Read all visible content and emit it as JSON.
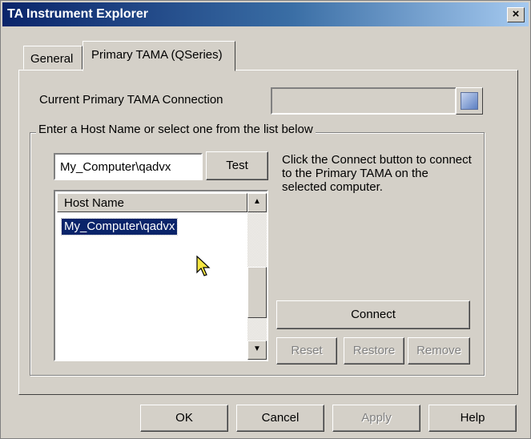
{
  "window": {
    "title": "TA Instrument Explorer",
    "close_label": "×"
  },
  "tabs": [
    {
      "label": "General"
    },
    {
      "label": "Primary TAMA (QSeries)"
    }
  ],
  "connection": {
    "label": "Current Primary TAMA Connection",
    "value": ""
  },
  "group": {
    "legend": "Enter a Host Name or select one from the list below",
    "host_input_value": "My_Computer\\qadvx",
    "test_label": "Test",
    "help_text": "Click the Connect button to connect to the Primary TAMA on the selected computer.",
    "list": {
      "column_header": "Host Name",
      "items": [
        {
          "label": "My_Computer\\qadvx",
          "selected": true
        }
      ]
    },
    "connect_label": "Connect",
    "reset_label": "Reset",
    "restore_label": "Restore",
    "remove_label": "Remove"
  },
  "footer": {
    "ok_label": "OK",
    "cancel_label": "Cancel",
    "apply_label": "Apply",
    "help_label": "Help"
  },
  "colors": {
    "title_start": "#0a246a",
    "title_end": "#a6caf0",
    "face": "#d4d0c8",
    "selection": "#0a246a",
    "cursor": "#f5e642"
  },
  "icons": {
    "connection_browse": "network-icon",
    "scroll_up": "arrow-up-icon",
    "scroll_down": "arrow-down-icon",
    "pointer": "mouse-cursor-icon"
  }
}
